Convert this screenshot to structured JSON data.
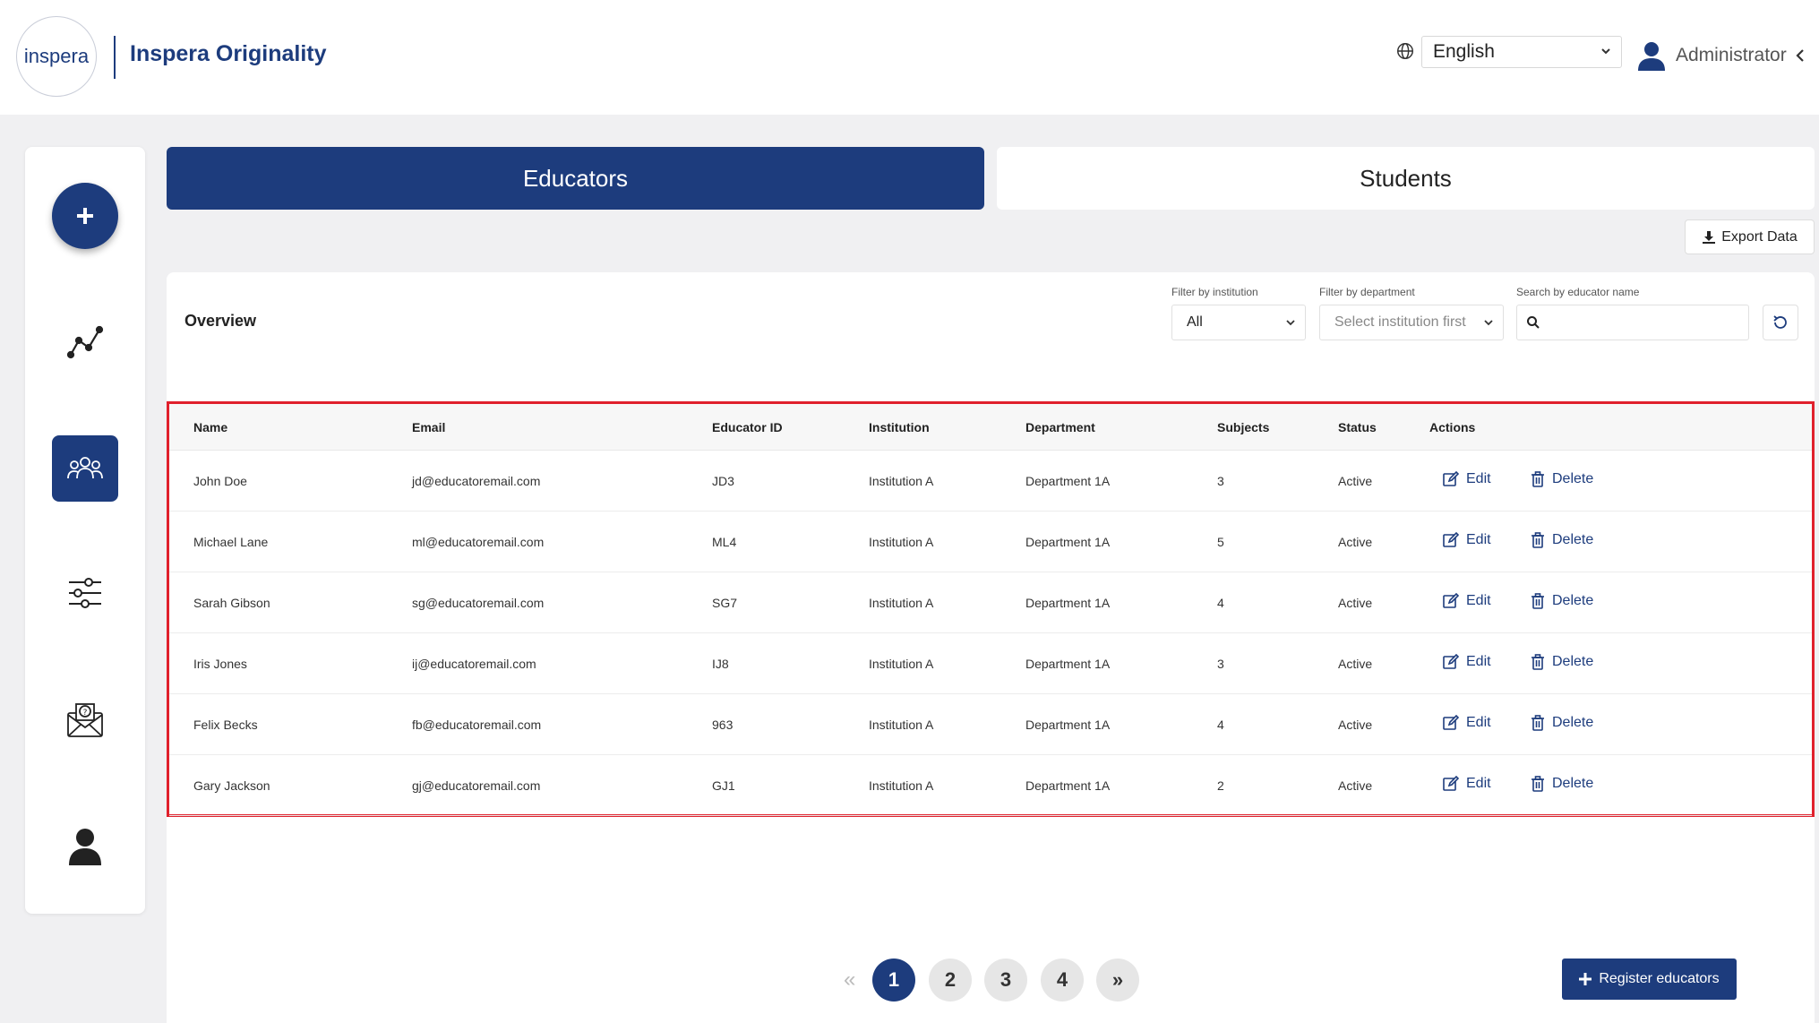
{
  "header": {
    "logo_text": "inspera",
    "app_title": "Inspera Originality",
    "language": "English",
    "user_name": "Administrator",
    "icons": [
      "globe-icon",
      "chevron-down-icon",
      "user-icon",
      "chevron-left-icon"
    ]
  },
  "sidebar": {
    "items": [
      {
        "name": "add",
        "icon": "plus-icon"
      },
      {
        "name": "analytics",
        "icon": "line-chart-icon"
      },
      {
        "name": "users",
        "icon": "users-group-icon",
        "active": true
      },
      {
        "name": "settings",
        "icon": "sliders-icon"
      },
      {
        "name": "support",
        "icon": "mail-question-icon"
      },
      {
        "name": "profile",
        "icon": "user-icon"
      }
    ]
  },
  "tabs": {
    "educators": "Educators",
    "students": "Students"
  },
  "export_label": "Export Data",
  "overview": {
    "title": "Overview",
    "filter_institution_label": "Filter by institution",
    "filter_institution_value": "All",
    "filter_department_label": "Filter by department",
    "filter_department_value": "Select institution first",
    "search_label": "Search by educator name",
    "search_value": ""
  },
  "table": {
    "columns": [
      "Name",
      "Email",
      "Educator ID",
      "Institution",
      "Department",
      "Subjects",
      "Status",
      "Actions"
    ],
    "rows": [
      {
        "name": "John Doe",
        "email": "jd@educatoremail.com",
        "id": "JD3",
        "institution": "Institution A",
        "department": "Department 1A",
        "subjects": "3",
        "status": "Active"
      },
      {
        "name": "Michael Lane",
        "email": "ml@educatoremail.com",
        "id": "ML4",
        "institution": "Institution A",
        "department": "Department 1A",
        "subjects": "5",
        "status": "Active"
      },
      {
        "name": "Sarah Gibson",
        "email": "sg@educatoremail.com",
        "id": "SG7",
        "institution": "Institution A",
        "department": "Department 1A",
        "subjects": "4",
        "status": "Active"
      },
      {
        "name": "Iris Jones",
        "email": "ij@educatoremail.com",
        "id": "IJ8",
        "institution": "Institution A",
        "department": "Department 1A",
        "subjects": "3",
        "status": "Active"
      },
      {
        "name": "Felix Becks",
        "email": "fb@educatoremail.com",
        "id": "963",
        "institution": "Institution A",
        "department": "Department 1A",
        "subjects": "4",
        "status": "Active"
      },
      {
        "name": "Gary Jackson",
        "email": "gj@educatoremail.com",
        "id": "GJ1",
        "institution": "Institution A",
        "department": "Department 1A",
        "subjects": "2",
        "status": "Active"
      }
    ],
    "edit_label": "Edit",
    "delete_label": "Delete"
  },
  "pagination": {
    "prev": "«",
    "pages": [
      "1",
      "2",
      "3",
      "4"
    ],
    "current": "1",
    "next": "»"
  },
  "register_label": "Register educators",
  "colors": {
    "primary": "#1d3c7d",
    "highlight_border": "#e0202c",
    "background": "#f0f0f2"
  }
}
